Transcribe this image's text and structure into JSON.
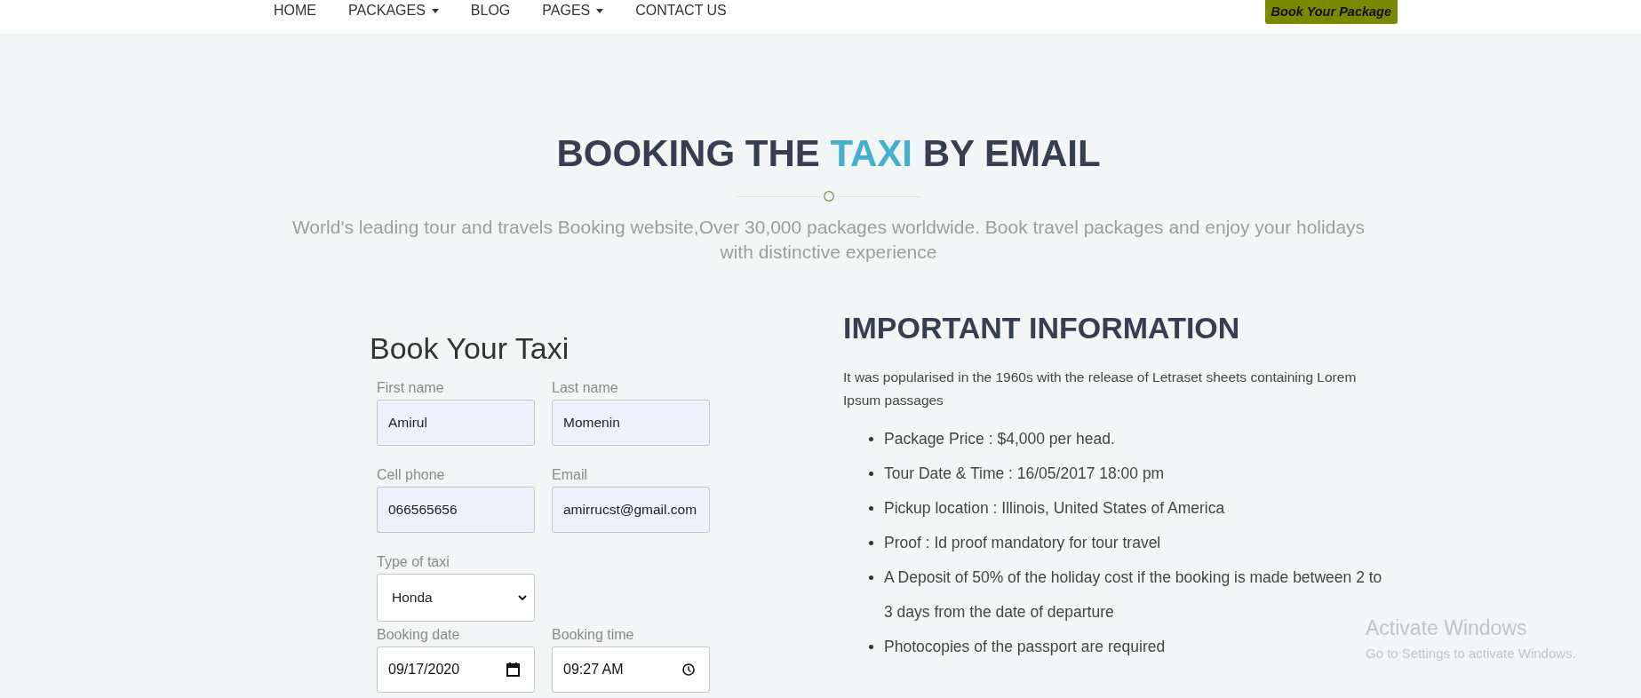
{
  "nav": {
    "items": [
      {
        "label": "HOME",
        "dropdown": false
      },
      {
        "label": "PACKAGES",
        "dropdown": true
      },
      {
        "label": "BLOG",
        "dropdown": false
      },
      {
        "label": "PAGES",
        "dropdown": true
      },
      {
        "label": "CONTACT US",
        "dropdown": false
      }
    ],
    "cta": "Book Your Package"
  },
  "header": {
    "title": [
      {
        "text": "BOOKING THE",
        "highlighted": false
      },
      {
        "text": "TAXI",
        "highlighted": true
      },
      {
        "text": "BY EMAIL",
        "highlighted": false
      }
    ],
    "subtitle": "World's leading tour and travels Booking website,Over 30,000 packages worldwide. Book travel packages and enjoy your holidays with distinctive experience"
  },
  "booking_form": {
    "title": "Book Your Taxi",
    "rows": [
      [
        {
          "kind": "text",
          "label": "First name",
          "value": "Amirul"
        },
        {
          "kind": "text",
          "label": "Last name",
          "value": "Momenin"
        }
      ],
      [
        {
          "kind": "text",
          "label": "Cell phone",
          "value": "066565656"
        },
        {
          "kind": "text",
          "label": "Email",
          "value": "amirrucst@gmail.com"
        }
      ],
      [
        {
          "kind": "select",
          "label": "Type of taxi",
          "value": "Honda"
        }
      ],
      [
        {
          "kind": "date",
          "label": "Booking date",
          "value": "09/17/2020"
        },
        {
          "kind": "time",
          "label": "Booking time",
          "value": "09:27 AM"
        }
      ]
    ]
  },
  "info": {
    "title": "IMPORTANT INFORMATION",
    "intro": "It was popularised in the 1960s with the release of Letraset sheets containing Lorem Ipsum passages",
    "items": [
      "Package Price : $4,000 per head.",
      "Tour Date & Time : 16/05/2017 18:00 pm",
      "Pickup location : Illinois, United States of America",
      "Proof : Id proof mandatory for tour travel",
      "A Deposit of 50% of the holiday cost if the booking is made between 2 to 3 days from the date of departure",
      "Photocopies of the passport are required"
    ]
  },
  "os_overlay": {
    "title": "Activate Windows",
    "subtitle": "Go to Settings to activate Windows."
  }
}
